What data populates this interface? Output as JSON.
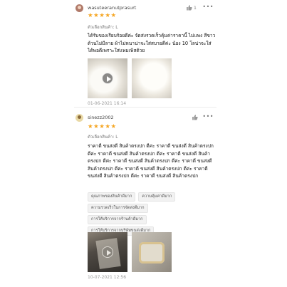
{
  "reviews": [
    {
      "username": "wasuteeranutprasurt",
      "rating": 5,
      "likes": "1",
      "more": "•••",
      "variant": "ตัวเลือกสินค้า: L",
      "text": "ได้รับของเรียบร้อยดีค่ะ จัดส่งรวดเร็วคุ้มค่าราคานี้ ไม่แพง สีขาวด้วนไม่มีลาย ผ้าไม่หนาน่าจะใส่สบายดีค่ะ น้อง 10 โลน่าจะใส่ได้พอดีเพราะใส่แพมเพิสด้วย",
      "date": "01-06-2021 16:14",
      "media": [
        {
          "type": "video",
          "icon": "play-icon"
        },
        {
          "type": "image"
        }
      ]
    },
    {
      "username": "sinezz2002",
      "rating": 5,
      "likes": "",
      "more": "•••",
      "variant": "ตัวเลือกสินค้า: L",
      "text": "ราคาดี ขนส่งดี สินค้าตรงปก ดีค่ะ ราคาดี ขนส่งดี สินค้าตรงปก ดีค่ะ ราคาดี ขนส่งดี สินค้าตรงปก ดีค่ะ ราคาดี ขนส่งดี สินค้าตรงปก ดีค่ะ ราคาดี ขนส่งดี สินค้าตรงปก ดีค่ะ ราคาดี ขนส่งดี สินค้าตรงปก ดีค่ะ ราคาดี ขนส่งดี สินค้าตรงปก ดีค่ะ ราคาดี ขนส่งดี สินค้าตรงปก ดีค่ะ ราคาดี ขนส่งดี สินค้าตรงปก",
      "tags": [
        [
          "คุณภาพของสินค้าดีมาก",
          "ความคุ้มค่าดีมาก"
        ],
        [
          "ความรวดเร็วในการจัดส่งดีมาก"
        ],
        [
          "การให้บริการจากร้านค้าดีมาก"
        ],
        [
          "การให้บริการจากบริษัทขนส่งดีมาก"
        ]
      ],
      "date": "10-07-2021 12:56",
      "media": [
        {
          "type": "video",
          "icon": "play-icon"
        },
        {
          "type": "image"
        }
      ]
    }
  ],
  "icons": {
    "star": "★",
    "like": "thumbs-up-icon",
    "more": "more-icon"
  },
  "colors": {
    "star": "#f5a623",
    "muted_text": "#777777",
    "tag_bg": "#f2f2f2"
  }
}
